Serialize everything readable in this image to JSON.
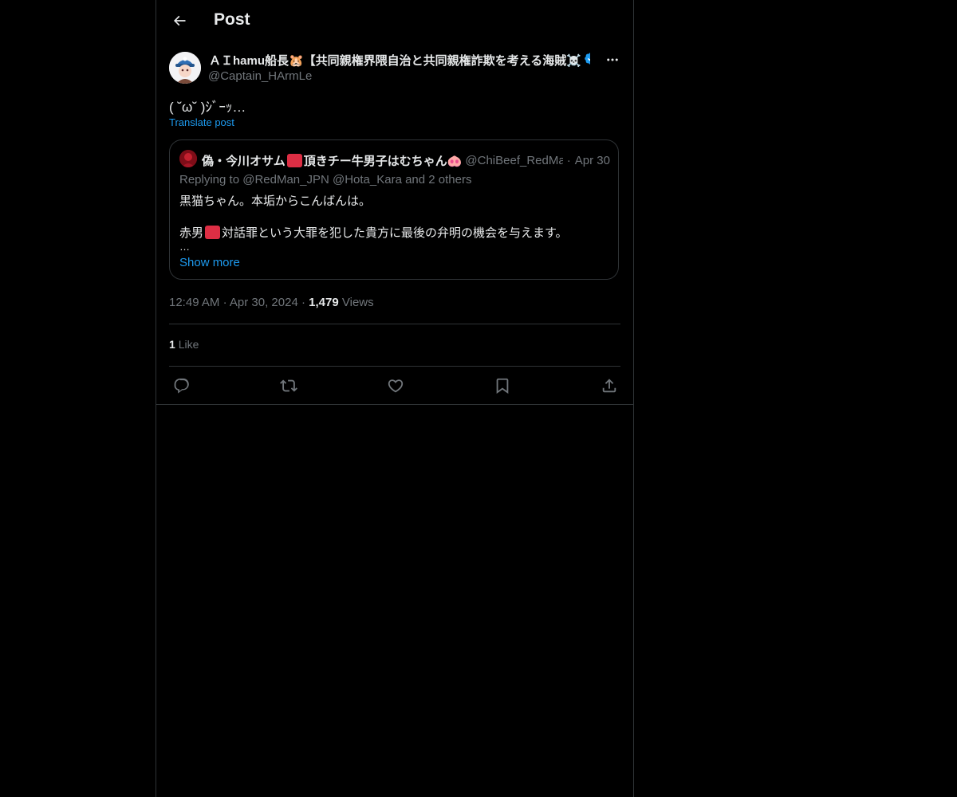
{
  "header": {
    "title": "Post",
    "back_icon": "arrow-left-icon"
  },
  "post": {
    "author_name": "ＡＩhamu船長🐹【共同親権界隈自治と共同親権詐欺を考える海賊☠️",
    "author_handle": "@Captain_HArmLe",
    "verified_icon": "verified-badge-icon",
    "text": "( ˘ω˘ )ｼﾞｰｯ…",
    "translate_label": "Translate post",
    "time": "12:49 AM",
    "date": "Apr 30, 2024",
    "views_count": "1,479",
    "views_label": "Views",
    "likes_count": "1",
    "likes_label": "Like"
  },
  "quote": {
    "name_part1": "偽・今川オサム",
    "name_part2": "頂きチー牛男子はむちゃん",
    "handle": "@ChiBeef_RedMan",
    "separator": "·",
    "date": "Apr 30",
    "replying": "Replying to @RedMan_JPN @Hota_Kara and 2 others",
    "line1": "黒猫ちゃん。本垢からこんばんは。",
    "line2_prefix": "赤男",
    "line2_rest": "対話罪という大罪を犯した貴方に最後の弁明の機会を与えます。",
    "ellipsis": "…",
    "show_more": "Show more"
  },
  "actions": {
    "reply_icon": "reply-icon",
    "repost_icon": "repost-icon",
    "like_icon": "heart-icon",
    "bookmark_icon": "bookmark-icon",
    "share_icon": "share-icon"
  },
  "colors": {
    "background": "#000000",
    "text": "#e7e9ea",
    "secondary": "#71767b",
    "accent": "#1d9bf0",
    "border": "#2f3336",
    "red_emoji": "#dd2e44"
  }
}
